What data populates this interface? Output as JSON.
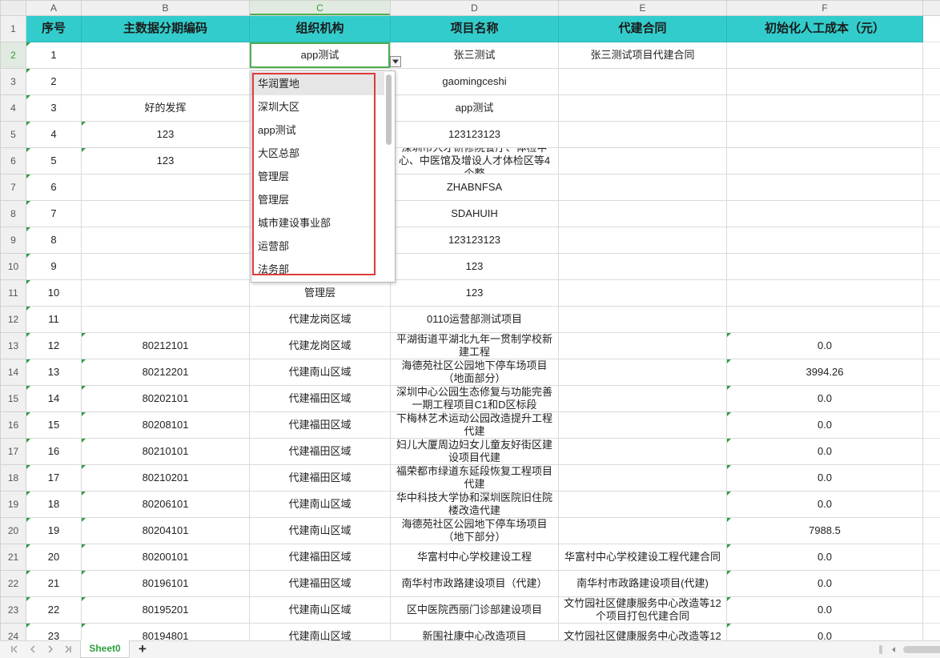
{
  "colors": {
    "header_fill": "#33cccc",
    "selection": "#4caf50",
    "sheet_tab_text": "#2e9e3e",
    "annotation_box": "#dd3b3b",
    "text_number_marker": "#2e9e3e"
  },
  "columns": [
    "A",
    "B",
    "C",
    "D",
    "E",
    "F"
  ],
  "selection": {
    "row": 2,
    "col": 3
  },
  "header": {
    "row": "1",
    "cells": [
      "序号",
      "主数据分期编码",
      "组织机构",
      "项目名称",
      "代建合同",
      "初始化人工成本（元）"
    ]
  },
  "rows": [
    {
      "row": "2",
      "cells": [
        "1",
        "",
        "app测试",
        "张三测试",
        "张三测试项目代建合同",
        ""
      ]
    },
    {
      "row": "3",
      "cells": [
        "2",
        "",
        "",
        "gaomingceshi",
        "",
        ""
      ]
    },
    {
      "row": "4",
      "cells": [
        "3",
        "好的发挥",
        "",
        "app测试",
        "",
        ""
      ]
    },
    {
      "row": "5",
      "cells": [
        "4",
        "123",
        "",
        "123123123",
        "",
        ""
      ]
    },
    {
      "row": "6",
      "cells": [
        "5",
        "123",
        "",
        "深圳市人才研修院餐厅、体检中心、中医馆及增设人才体检区等4个整",
        "",
        ""
      ]
    },
    {
      "row": "7",
      "cells": [
        "6",
        "",
        "",
        "ZHABNFSA",
        "",
        ""
      ]
    },
    {
      "row": "8",
      "cells": [
        "7",
        "",
        "",
        "SDAHUIH",
        "",
        ""
      ]
    },
    {
      "row": "9",
      "cells": [
        "8",
        "",
        "",
        "123123123",
        "",
        ""
      ]
    },
    {
      "row": "10",
      "cells": [
        "9",
        "",
        "",
        "123",
        "",
        ""
      ]
    },
    {
      "row": "11",
      "cells": [
        "10",
        "",
        "管理层",
        "123",
        "",
        ""
      ]
    },
    {
      "row": "12",
      "cells": [
        "11",
        "",
        "代建龙岗区域",
        "0110运营部测试项目",
        "",
        ""
      ]
    },
    {
      "row": "13",
      "cells": [
        "12",
        "80212101",
        "代建龙岗区域",
        "平湖街道平湖北九年一贯制学校新建工程",
        "",
        "0.0"
      ]
    },
    {
      "row": "14",
      "cells": [
        "13",
        "80212201",
        "代建南山区域",
        "海德苑社区公园地下停车场项目（地面部分）",
        "",
        "3994.26"
      ]
    },
    {
      "row": "15",
      "cells": [
        "14",
        "80202101",
        "代建福田区域",
        "深圳中心公园生态修复与功能完善一期工程项目C1和D区标段",
        "",
        "0.0"
      ]
    },
    {
      "row": "16",
      "cells": [
        "15",
        "80208101",
        "代建福田区域",
        "下梅林艺术运动公园改造提升工程代建",
        "",
        "0.0"
      ]
    },
    {
      "row": "17",
      "cells": [
        "16",
        "80210101",
        "代建福田区域",
        "妇儿大厦周边妇女儿童友好街区建设项目代建",
        "",
        "0.0"
      ]
    },
    {
      "row": "18",
      "cells": [
        "17",
        "80210201",
        "代建福田区域",
        "福荣都市绿道东延段恢复工程项目代建",
        "",
        "0.0"
      ]
    },
    {
      "row": "19",
      "cells": [
        "18",
        "80206101",
        "代建南山区域",
        "华中科技大学协和深圳医院旧住院楼改造代建",
        "",
        "0.0"
      ]
    },
    {
      "row": "20",
      "cells": [
        "19",
        "80204101",
        "代建南山区域",
        "海德苑社区公园地下停车场项目（地下部分）",
        "",
        "7988.5"
      ]
    },
    {
      "row": "21",
      "cells": [
        "20",
        "80200101",
        "代建福田区域",
        "华富村中心学校建设工程",
        "华富村中心学校建设工程代建合同",
        "0.0"
      ]
    },
    {
      "row": "22",
      "cells": [
        "21",
        "80196101",
        "代建福田区域",
        "南华村市政路建设项目（代建）",
        "南华村市政路建设项目(代建)",
        "0.0"
      ]
    },
    {
      "row": "23",
      "cells": [
        "22",
        "80195201",
        "代建南山区域",
        "区中医院西丽门诊部建设项目",
        "文竹园社区健康服务中心改造等12个项目打包代建合同",
        "0.0"
      ]
    },
    {
      "row": "24",
      "cells": [
        "23",
        "80194801",
        "代建南山区域",
        "新围社康中心改造项目",
        "文竹园社区健康服务中心改造等12",
        "0.0"
      ]
    }
  ],
  "dropdown": {
    "arrow_icon": "chevron-down-icon",
    "options": [
      "华润置地",
      "深圳大区",
      "app测试",
      "大区总部",
      "管理层",
      "管理层",
      "城市建设事业部",
      "运营部",
      "法务部"
    ],
    "highlighted_index": 0
  },
  "sheet_bar": {
    "nav_icons": [
      "first-sheet-icon",
      "prev-sheet-icon",
      "next-sheet-icon",
      "last-sheet-icon"
    ],
    "tabs": [
      "Sheet0"
    ],
    "active_tab": 0,
    "add_label": "+",
    "scroll_icons": [
      "scroll-grip-icon",
      "scroll-left-icon"
    ]
  }
}
